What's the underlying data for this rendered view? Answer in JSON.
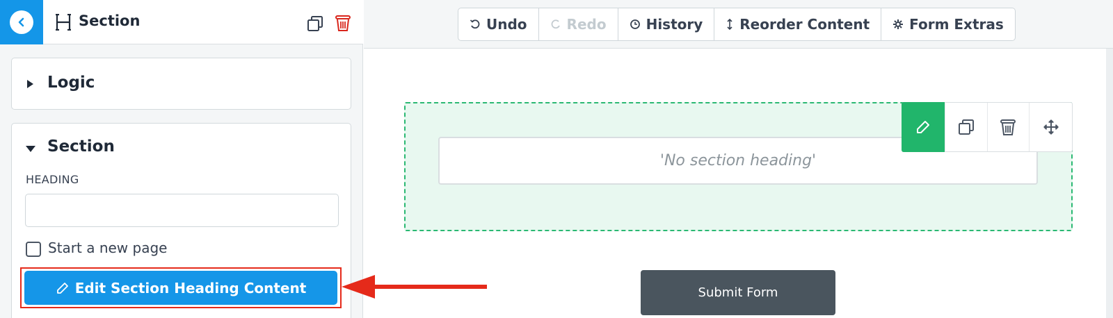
{
  "sidebar": {
    "header": {
      "title": "Section",
      "back_icon": "chevron-left-icon",
      "section_icon": "heading-icon",
      "duplicate_icon": "duplicate-icon",
      "delete_icon": "trash-icon"
    },
    "logic_panel": {
      "title": "Logic",
      "expanded": false
    },
    "section_panel": {
      "title": "Section",
      "expanded": true,
      "heading_label": "HEADING",
      "heading_value": "",
      "new_page_label": "Start a new page",
      "new_page_checked": false,
      "edit_button_label": "Edit Section Heading Content"
    }
  },
  "toolbar": {
    "undo": "Undo",
    "redo": "Redo",
    "history": "History",
    "reorder": "Reorder Content",
    "extras": "Form Extras"
  },
  "canvas": {
    "section_heading_placeholder": "'No section heading'",
    "submit_label": "Submit Form"
  },
  "colors": {
    "primary": "#1596e8",
    "accent_green": "#21b56b",
    "delete_red": "#d9261c",
    "annotation_red": "#e52a1a",
    "submit": "#4a555e"
  }
}
